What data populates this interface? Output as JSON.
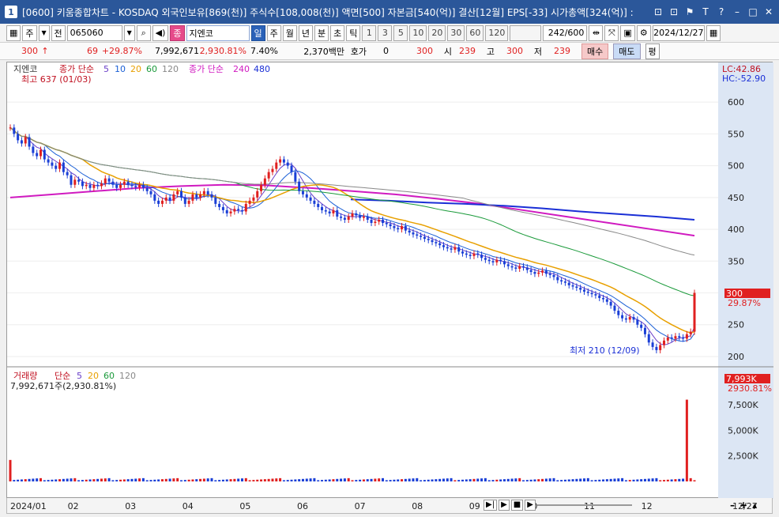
{
  "window": {
    "title": "[0600] 키움종합차트 - KOSDAQ 외국인보유[869(천)] 주식수[108,008(천)] 액면[500] 자본금[540(억)] 결산[12월] EPS[-33] 시가총액[324(억)] :",
    "badge": "1",
    "btns": [
      "⊡",
      "⊡",
      "⚑",
      "T",
      "?",
      "–",
      "□",
      "✕"
    ]
  },
  "toolbar": {
    "type": "주",
    "prev": "전",
    "code": "065060",
    "name_tag": "종",
    "name": "지엔코",
    "periods": [
      "일",
      "주",
      "월",
      "년",
      "분",
      "초",
      "틱"
    ],
    "counts": [
      "1",
      "3",
      "5",
      "10",
      "20",
      "30",
      "60",
      "120"
    ],
    "range": "242/600",
    "date": "2024/12/27"
  },
  "quote": {
    "price": "300",
    "arrow": "↑",
    "change": "69",
    "change_pct": "+29.87%",
    "volume": "7,992,671",
    "vol_pct": "2,930.81%",
    "turnover": "7.40%",
    "amount": "2,370백만",
    "ask_label": "호가",
    "ask": "0",
    "bid": "300",
    "open_label": "시",
    "open": "239",
    "high_label": "고",
    "high": "300",
    "low_label": "저",
    "low": "239",
    "sell": "매수",
    "buy": "매도",
    "avg": "평"
  },
  "price_panel": {
    "legend_name": "지엔코",
    "ma_label": "종가 단순",
    "mas": [
      "5",
      "10",
      "20",
      "60",
      "120"
    ],
    "ma_colors": [
      "#6a3fc8",
      "#1a5fd6",
      "#e8a000",
      "#1a9a3a",
      "#888888"
    ],
    "long_label": "종가 단순",
    "long_mas": [
      "240",
      "480"
    ],
    "long_colors": [
      "#d01ac0",
      "#1a2fd6"
    ],
    "high_note": "최고 637 (01/03)",
    "low_note": "최저 210 (12/09)",
    "lc": "LC:42.86",
    "hc": "HC:-52.90",
    "cur_price": "300",
    "cur_pct": "29.87%"
  },
  "volume_panel": {
    "label": "거래량",
    "ma_label": "단순",
    "mas": [
      "5",
      "20",
      "60",
      "120"
    ],
    "value": "7,992,671주(2,930.81%)",
    "cur": "7,993K",
    "cur_pct": "2930.81%"
  },
  "xaxis": {
    "labels": [
      "2024/01",
      "02",
      "03",
      "04",
      "05",
      "06",
      "07",
      "08",
      "09",
      "10",
      "11",
      "12"
    ],
    "end": "12/27"
  },
  "chart_data": {
    "type": "candlestick",
    "yticks_price": [
      200,
      250,
      300,
      350,
      400,
      450,
      500,
      550,
      600
    ],
    "ylim_price": [
      190,
      640
    ],
    "yticks_vol": [
      "2,500K",
      "5,000K",
      "7,500K"
    ],
    "ylim_vol": [
      0,
      8500000
    ],
    "closes": [
      560,
      550,
      540,
      535,
      545,
      530,
      520,
      515,
      525,
      510,
      505,
      500,
      495,
      505,
      490,
      485,
      470,
      478,
      475,
      468,
      470,
      465,
      470,
      468,
      472,
      480,
      475,
      470,
      465,
      470,
      475,
      470,
      468,
      466,
      470,
      465,
      460,
      455,
      445,
      440,
      445,
      450,
      445,
      455,
      460,
      450,
      440,
      445,
      455,
      450,
      455,
      460,
      455,
      450,
      440,
      435,
      430,
      425,
      428,
      432,
      430,
      428,
      440,
      445,
      450,
      460,
      470,
      480,
      490,
      495,
      505,
      510,
      505,
      500,
      490,
      475,
      460,
      455,
      450,
      445,
      440,
      435,
      430,
      428,
      425,
      430,
      420,
      418,
      415,
      420,
      425,
      422,
      418,
      420,
      415,
      410,
      412,
      415,
      410,
      408,
      405,
      402,
      400,
      405,
      398,
      395,
      392,
      390,
      388,
      385,
      383,
      380,
      378,
      375,
      372,
      370,
      368,
      372,
      365,
      362,
      360,
      358,
      362,
      360,
      355,
      352,
      350,
      348,
      352,
      350,
      345,
      342,
      340,
      338,
      342,
      340,
      336,
      333,
      330,
      332,
      335,
      330,
      328,
      325,
      320,
      318,
      316,
      312,
      310,
      308,
      305,
      302,
      300,
      298,
      296,
      292,
      290,
      286,
      280,
      272,
      265,
      260,
      258,
      262,
      258,
      250,
      245,
      235,
      222,
      215,
      210,
      218,
      225,
      230,
      228,
      232,
      230,
      228,
      235,
      239,
      300
    ],
    "volume_spikes": [
      {
        "i": 0,
        "v": 2100000
      },
      {
        "i": 178,
        "v": 7992671
      }
    ]
  }
}
